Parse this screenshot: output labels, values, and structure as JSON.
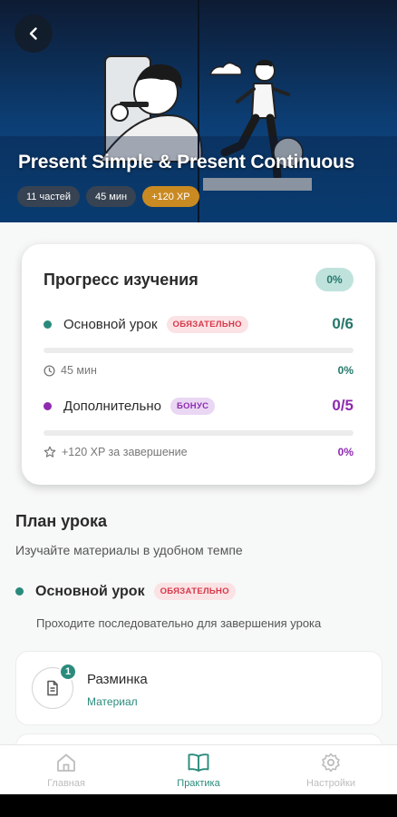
{
  "hero": {
    "title": "Present Simple & Present Continuous",
    "chips": {
      "parts": "11 частей",
      "duration": "45 мин",
      "xp": "+120 XP"
    }
  },
  "progress_card": {
    "title": "Прогресс изучения",
    "overall_percent": "0%",
    "main": {
      "label": "Основной урок",
      "tag": "ОБЯЗАТЕЛЬНО",
      "count": "0/6",
      "meta": "45 мин",
      "percent": "0%",
      "progress": 0
    },
    "extra": {
      "label": "Дополнительно",
      "tag": "БОНУС",
      "count": "0/5",
      "meta": "+120 XP за завершение",
      "percent": "0%",
      "progress": 0
    }
  },
  "plan": {
    "title": "План урока",
    "subtitle": "Изучайте материалы в удобном темпе",
    "section": {
      "label": "Основной урок",
      "tag": "ОБЯЗАТЕЛЬНО",
      "note": "Проходите последовательно для завершения урока"
    },
    "items": [
      {
        "number": "1",
        "title": "Разминка",
        "type": "Материал"
      }
    ]
  },
  "nav": [
    {
      "label": "Главная",
      "icon": "home-icon",
      "active": false
    },
    {
      "label": "Практика",
      "icon": "book-icon",
      "active": true
    },
    {
      "label": "Настройки",
      "icon": "gear-icon",
      "active": false
    }
  ],
  "colors": {
    "accent": "#2a8b7c",
    "required": "#d6384a",
    "bonus": "#8e2bb0",
    "xp": "#c98a22",
    "nav_inactive": "#bdbdbd"
  }
}
